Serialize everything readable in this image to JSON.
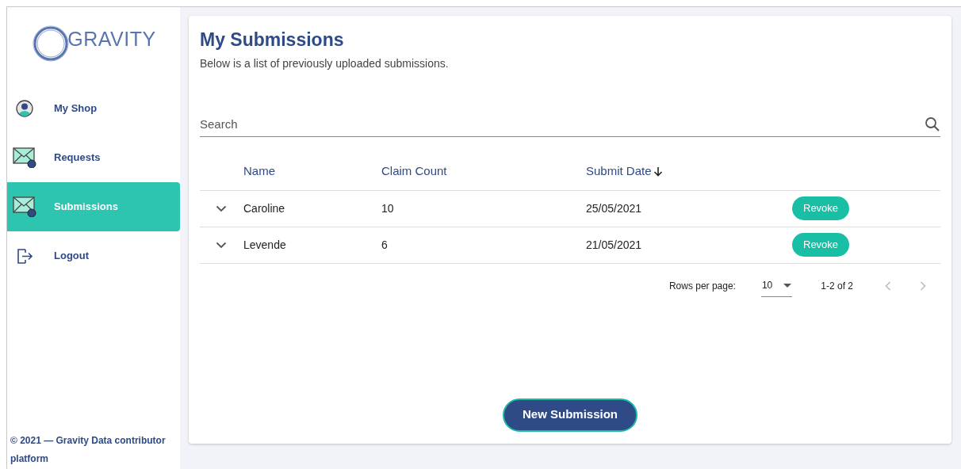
{
  "sidebar": {
    "logo_text": "GRAVITY",
    "items": [
      {
        "label": "My Shop",
        "kind": "user",
        "selected": false
      },
      {
        "label": "Requests",
        "kind": "inbox",
        "selected": false
      },
      {
        "label": "Submissions",
        "kind": "outbox",
        "selected": true
      },
      {
        "label": "Logout",
        "kind": "logout",
        "selected": false
      }
    ],
    "footer": "© 2021 — Gravity Data contributor platform"
  },
  "page": {
    "title": "My Submissions",
    "subtitle": "Below is a list of previously uploaded submissions."
  },
  "search": {
    "placeholder": "Search"
  },
  "table": {
    "columns": [
      {
        "label": "Name",
        "sorted": false
      },
      {
        "label": "Claim Count",
        "sorted": false
      },
      {
        "label": "Submit Date",
        "sorted": true
      }
    ],
    "rows": [
      {
        "name": "Caroline",
        "claim_count": "10",
        "submit_date": "25/05/2021",
        "action": "Revoke"
      },
      {
        "name": "Levende",
        "claim_count": "6",
        "submit_date": "21/05/2021",
        "action": "Revoke"
      }
    ]
  },
  "pagination": {
    "rows_per_page_label": "Rows per page:",
    "rows_per_page": "10",
    "range": "1-2 of 2"
  },
  "new_button": "New Submission"
}
